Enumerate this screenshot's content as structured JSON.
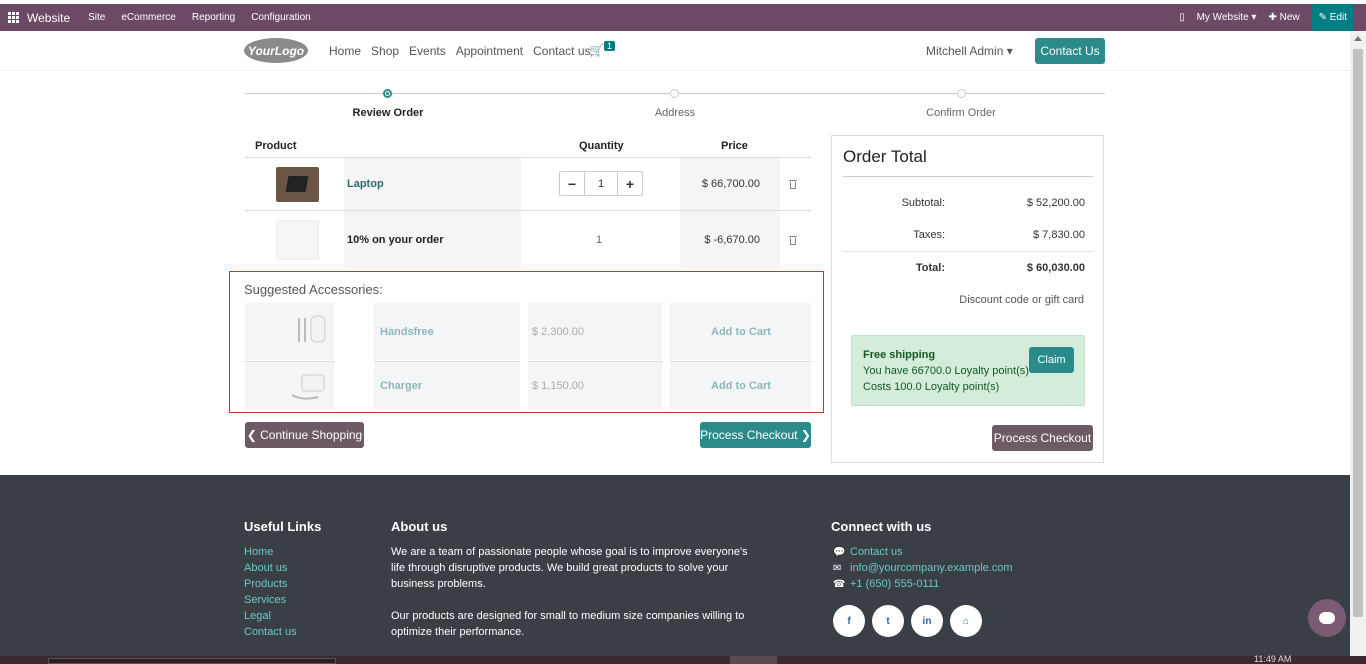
{
  "topbar": {
    "app_name": "Website",
    "menu": [
      "Site",
      "eCommerce",
      "Reporting",
      "Configuration"
    ],
    "my_website": "My Website ▾",
    "new_label": "✚ New",
    "edit_label": "✎ Edit"
  },
  "header": {
    "logo_text": "YourLogo",
    "nav": [
      "Home",
      "Shop",
      "Events",
      "Appointment",
      "Contact us"
    ],
    "cart_count": "1",
    "user": "Mitchell Admin ▾",
    "contact_button": "Contact Us"
  },
  "wizard": {
    "steps": [
      "Review Order",
      "Address",
      "Confirm Order"
    ],
    "active_step": 0
  },
  "cart": {
    "headers": {
      "product": "Product",
      "quantity": "Quantity",
      "price": "Price"
    },
    "lines": [
      {
        "name": "Laptop",
        "quantity": "1",
        "price": "$ 66,700.00"
      },
      {
        "name": "10% on your order",
        "quantity": "1",
        "price": "$ -6,670.00"
      }
    ]
  },
  "accessories": {
    "title": "Suggested Accessories:",
    "items": [
      {
        "name": "Handsfree",
        "price": "$ 2,300.00",
        "action": "Add to Cart"
      },
      {
        "name": "Charger",
        "price": "$ 1,150.00",
        "action": "Add to Cart"
      }
    ]
  },
  "buttons": {
    "continue": "❮ Continue Shopping",
    "process": "Process Checkout ❯",
    "process_right": "Process Checkout"
  },
  "order_total": {
    "title": "Order Total",
    "subtotal_label": "Subtotal:",
    "subtotal": "$ 52,200.00",
    "taxes_label": "Taxes:",
    "taxes": "$ 7,830.00",
    "total_label": "Total:",
    "total": "$ 60,030.00",
    "discount_link": "Discount code or gift card",
    "loyalty": {
      "title": "Free shipping",
      "line1": "You have 66700.0 Loyalty point(s)",
      "line2": "Costs 100.0 Loyalty point(s)",
      "claim": "Claim"
    }
  },
  "footer": {
    "useful_links_title": "Useful Links",
    "useful_links": [
      "Home",
      "About us",
      "Products",
      "Services",
      "Legal",
      "Contact us"
    ],
    "about_title": "About us",
    "about_p1_l1": "We are a team of passionate people whose goal is to improve everyone's",
    "about_p1_l2": "life through disruptive products. We build great products to solve your",
    "about_p1_l3": "business problems.",
    "about_p2_l1": "Our products are designed for small to medium size companies willing to",
    "about_p2_l2": "optimize their performance.",
    "connect_title": "Connect with us",
    "contact_link": "Contact us",
    "email": "info@yourcompany.example.com",
    "phone": "+1 (650) 555-0111",
    "social": [
      "f",
      "t",
      "in",
      "⌂"
    ]
  },
  "taskbar": {
    "clock": "11:49 AM"
  },
  "colors": {
    "brand": "#6c4a65",
    "accent": "#2b8a8a",
    "footer": "#3a3f45"
  }
}
